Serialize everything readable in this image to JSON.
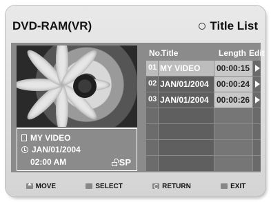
{
  "header": {
    "disc_type": "DVD-RAM(VR)",
    "menu_name": "Title List"
  },
  "preview": {
    "title": "MY VIDEO",
    "date": "JAN/01/2004",
    "time": "02:00 AM",
    "quality": "SP"
  },
  "list": {
    "columns": {
      "no": "No.",
      "title": "Title",
      "length": "Length",
      "edit": "Edit"
    },
    "rows": [
      {
        "no": "01",
        "title": "MY VIDEO",
        "length": "00:00:15",
        "selected": true
      },
      {
        "no": "02",
        "title": "JAN/01/2004",
        "length": "00:00:24",
        "selected": false
      },
      {
        "no": "03",
        "title": "JAN/01/2004",
        "length": "00:00:26",
        "selected": false
      }
    ],
    "empty_rows": 4
  },
  "footer": {
    "move": "MOVE",
    "select": "SELECT",
    "return": "RETURN",
    "exit": "EXIT"
  },
  "colors": {
    "frame": "#dedede",
    "panel": "#8b8b8b",
    "selected_row": "#bdbdbd"
  }
}
